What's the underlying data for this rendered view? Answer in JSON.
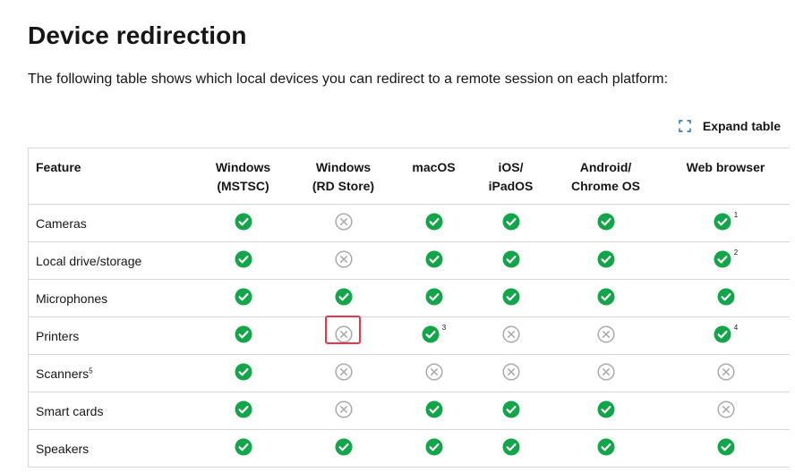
{
  "page": {
    "title": "Device redirection",
    "intro": "The following table shows which local devices you can redirect to a remote session on each platform:",
    "expand_label": "Expand table"
  },
  "table": {
    "feature_header": "Feature",
    "platforms": [
      {
        "line1": "Windows",
        "line2": "(MSTSC)"
      },
      {
        "line1": "Windows",
        "line2": "(RD Store)"
      },
      {
        "line1": "macOS",
        "line2": ""
      },
      {
        "line1": "iOS/",
        "line2": "iPadOS"
      },
      {
        "line1": "Android/",
        "line2": "Chrome OS"
      },
      {
        "line1": "Web browser",
        "line2": ""
      }
    ],
    "rows": [
      {
        "feature": "Cameras",
        "sup": "",
        "cells": [
          {
            "supported": true,
            "note": ""
          },
          {
            "supported": false,
            "note": ""
          },
          {
            "supported": true,
            "note": ""
          },
          {
            "supported": true,
            "note": ""
          },
          {
            "supported": true,
            "note": ""
          },
          {
            "supported": true,
            "note": "1"
          }
        ]
      },
      {
        "feature": "Local drive/storage",
        "sup": "",
        "cells": [
          {
            "supported": true,
            "note": ""
          },
          {
            "supported": false,
            "note": ""
          },
          {
            "supported": true,
            "note": ""
          },
          {
            "supported": true,
            "note": ""
          },
          {
            "supported": true,
            "note": ""
          },
          {
            "supported": true,
            "note": "2"
          }
        ]
      },
      {
        "feature": "Microphones",
        "sup": "",
        "cells": [
          {
            "supported": true,
            "note": ""
          },
          {
            "supported": true,
            "note": ""
          },
          {
            "supported": true,
            "note": ""
          },
          {
            "supported": true,
            "note": ""
          },
          {
            "supported": true,
            "note": ""
          },
          {
            "supported": true,
            "note": ""
          }
        ]
      },
      {
        "feature": "Printers",
        "sup": "",
        "cells": [
          {
            "supported": true,
            "note": ""
          },
          {
            "supported": false,
            "note": "",
            "highlighted": true
          },
          {
            "supported": true,
            "note": "3"
          },
          {
            "supported": false,
            "note": ""
          },
          {
            "supported": false,
            "note": ""
          },
          {
            "supported": true,
            "note": "4"
          }
        ]
      },
      {
        "feature": "Scanners",
        "sup": "5",
        "cells": [
          {
            "supported": true,
            "note": ""
          },
          {
            "supported": false,
            "note": ""
          },
          {
            "supported": false,
            "note": ""
          },
          {
            "supported": false,
            "note": ""
          },
          {
            "supported": false,
            "note": ""
          },
          {
            "supported": false,
            "note": ""
          }
        ]
      },
      {
        "feature": "Smart cards",
        "sup": "",
        "cells": [
          {
            "supported": true,
            "note": ""
          },
          {
            "supported": false,
            "note": ""
          },
          {
            "supported": true,
            "note": ""
          },
          {
            "supported": true,
            "note": ""
          },
          {
            "supported": true,
            "note": ""
          },
          {
            "supported": false,
            "note": ""
          }
        ]
      },
      {
        "feature": "Speakers",
        "sup": "",
        "cells": [
          {
            "supported": true,
            "note": ""
          },
          {
            "supported": true,
            "note": ""
          },
          {
            "supported": true,
            "note": ""
          },
          {
            "supported": true,
            "note": ""
          },
          {
            "supported": true,
            "note": ""
          },
          {
            "supported": true,
            "note": ""
          }
        ]
      }
    ]
  },
  "icons": {
    "supported": "check-circle-icon",
    "unsupported": "x-circle-icon",
    "expand": "expand-icon"
  },
  "colors": {
    "supported": "#12a54a",
    "unsupported": "#a9a9a9",
    "highlight": "#e8354a"
  }
}
